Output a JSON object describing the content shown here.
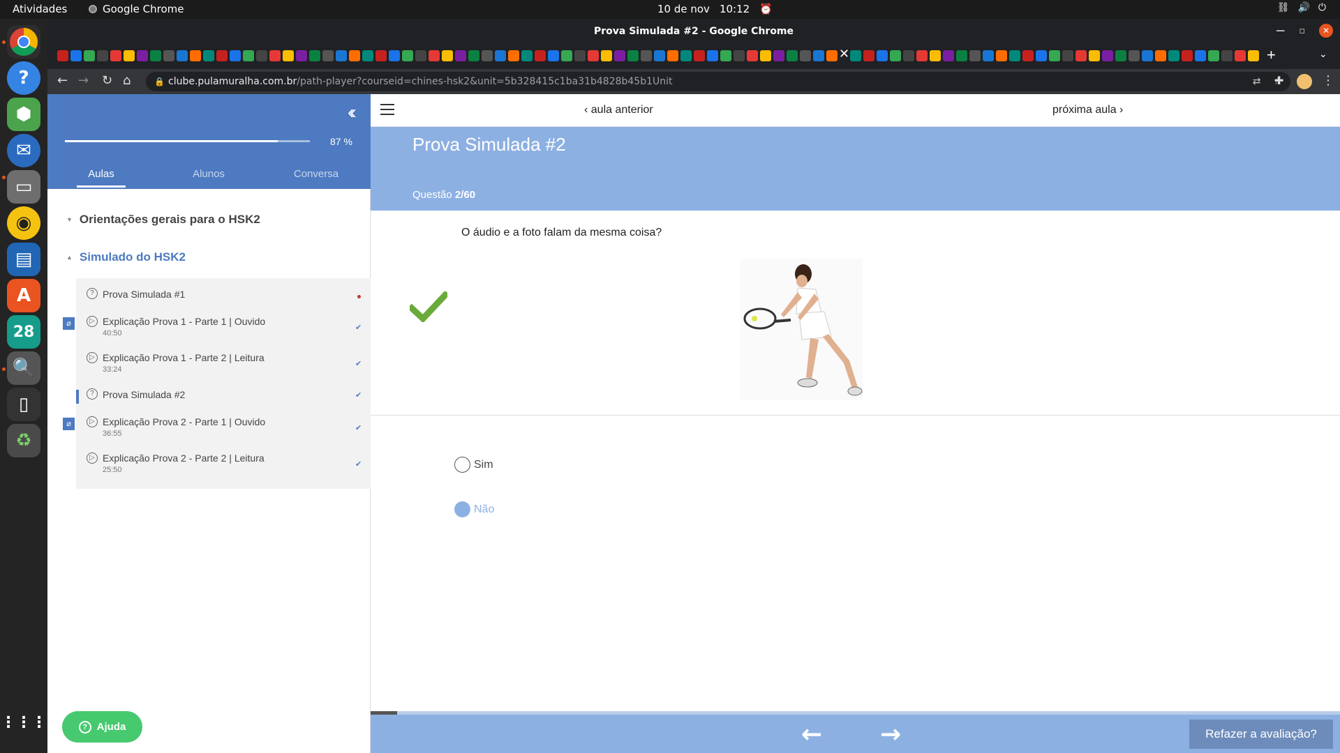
{
  "system_bar": {
    "activities": "Atividades",
    "app_name": "Google Chrome",
    "date": "10 de nov",
    "time": "10:12"
  },
  "window": {
    "title": "Prova Simulada #2 - Google Chrome"
  },
  "address_bar": {
    "host": "clube.pulamuralha.com.br",
    "path": "/path-player?courseid=chines-hsk2&unit=5b328415c1ba31b4828b45b1Unit"
  },
  "sidebar": {
    "progress_percent": 87,
    "progress_label": "87 %",
    "tabs": [
      {
        "label": "Aulas",
        "active": true
      },
      {
        "label": "Alunos",
        "active": false
      },
      {
        "label": "Conversa",
        "active": false
      }
    ],
    "sections": [
      {
        "title": "Orientações gerais para o HSK2",
        "expanded": false
      },
      {
        "title": "Simulado do HSK2",
        "expanded": true
      }
    ],
    "lessons": [
      {
        "title": "Prova Simulada #1",
        "duration": "",
        "type": "quiz",
        "status": "pending"
      },
      {
        "title": "Explicação Prova 1 - Parte 1 | Ouvido",
        "duration": "40:50",
        "type": "video",
        "status": "done",
        "attachment": true
      },
      {
        "title": "Explicação Prova 1 - Parte 2 | Leitura",
        "duration": "33:24",
        "type": "video",
        "status": "done"
      },
      {
        "title": "Prova Simulada #2",
        "duration": "",
        "type": "quiz",
        "status": "done",
        "current": true
      },
      {
        "title": "Explicação Prova 2 - Parte 1 | Ouvido",
        "duration": "36:55",
        "type": "video",
        "status": "done",
        "attachment": true
      },
      {
        "title": "Explicação Prova 2 - Parte 2 | Leitura",
        "duration": "25:50",
        "type": "video",
        "status": "done"
      }
    ],
    "help_label": "Ajuda"
  },
  "main": {
    "prev_label": "aula anterior",
    "next_label": "próxima aula",
    "page_title": "Prova Simulada #2",
    "question_label": "Questão",
    "question_count": "2/60",
    "question_text": "O áudio e a foto falam da mesma coisa?",
    "options": [
      {
        "label": "Sim",
        "selected": false
      },
      {
        "label": "Não",
        "selected": true
      }
    ],
    "redo_label": "Refazer a avaliação?",
    "quiz_progress_fraction": 0.027
  },
  "colors": {
    "accent": "#4d7ac0",
    "banner": "#8db0e3",
    "correct": "#6aaa3a",
    "help": "#47c96f"
  }
}
